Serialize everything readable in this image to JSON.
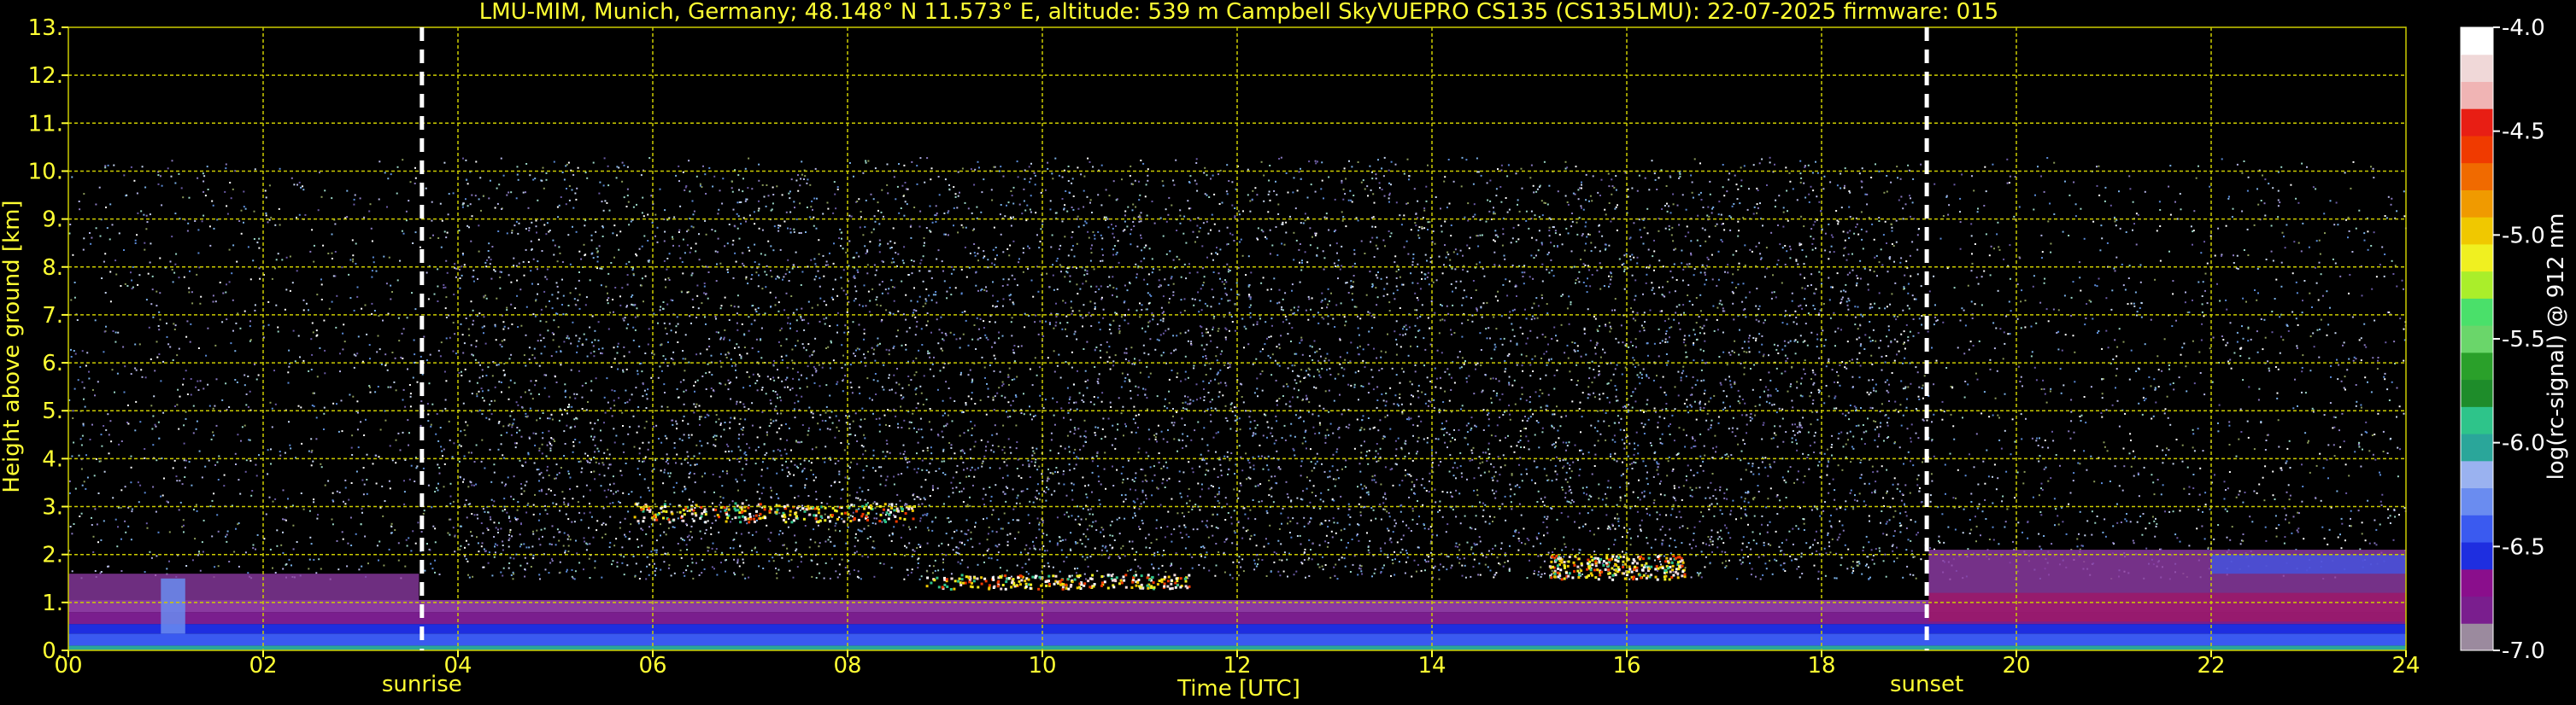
{
  "chart_data": {
    "type": "heatmap",
    "title": "LMU-MIM, Munich, Germany; 48.148° N 11.573° E, altitude: 539 m    Campbell SkyVUEPRO CS135 (CS135LMU): 22-07-2025    firmware: 015",
    "xlabel": "Time [UTC]",
    "ylabel": "Height above ground [km]",
    "xlim": [
      0,
      24
    ],
    "ylim": [
      0,
      13
    ],
    "x_ticks": [
      "00",
      "02",
      "04",
      "06",
      "08",
      "10",
      "12",
      "14",
      "16",
      "18",
      "20",
      "22",
      "24"
    ],
    "y_ticks": [
      "0.",
      "1.",
      "2.",
      "3.",
      "4.",
      "5.",
      "6.",
      "7.",
      "8.",
      "9.",
      "10.",
      "11.",
      "12.",
      "13."
    ],
    "grid": true,
    "annotations": [
      {
        "label": "sunrise",
        "x": 3.63
      },
      {
        "label": "sunset",
        "x": 19.08
      }
    ],
    "colorbar": {
      "label": "log(rc-signal) @ 912 nm",
      "range": [
        -7.0,
        -4.0
      ],
      "ticks": [
        "-4.0",
        "-4.5",
        "-5.0",
        "-5.5",
        "-6.0",
        "-6.5",
        "-7.0"
      ]
    },
    "layers": [
      {
        "name": "noise",
        "x_range": [
          0,
          24
        ],
        "y_range": [
          1.5,
          10.3
        ]
      },
      {
        "name": "boundary layer",
        "x_range": [
          0,
          24
        ],
        "y_range": [
          0,
          1.8
        ]
      },
      {
        "name": "cloud",
        "x_range": [
          5.8,
          8.7
        ],
        "y_range": [
          2.7,
          3.1
        ]
      },
      {
        "name": "cloud",
        "x_range": [
          8.8,
          11.5
        ],
        "y_range": [
          1.3,
          1.6
        ]
      },
      {
        "name": "cloud",
        "x_range": [
          15.2,
          16.6
        ],
        "y_range": [
          1.5,
          2.0
        ]
      }
    ]
  },
  "colors": {
    "background": "#000000",
    "text": "#ffff33",
    "grid": "#cccc00",
    "colorbar_stops": [
      "#9b8a9e",
      "#7a1e8e",
      "#8a0e8c",
      "#1e2ee0",
      "#3a5af0",
      "#6a8cf0",
      "#9ab2f0",
      "#2aa69a",
      "#2ec48a",
      "#1e8c2a",
      "#2aa02a",
      "#6ad66a",
      "#4ae06a",
      "#aaee2a",
      "#f0f020",
      "#f0c800",
      "#f09a00",
      "#f06a00",
      "#f03a00",
      "#e81e14",
      "#f0b4b4",
      "#f0d8d8",
      "#ffffff"
    ]
  }
}
